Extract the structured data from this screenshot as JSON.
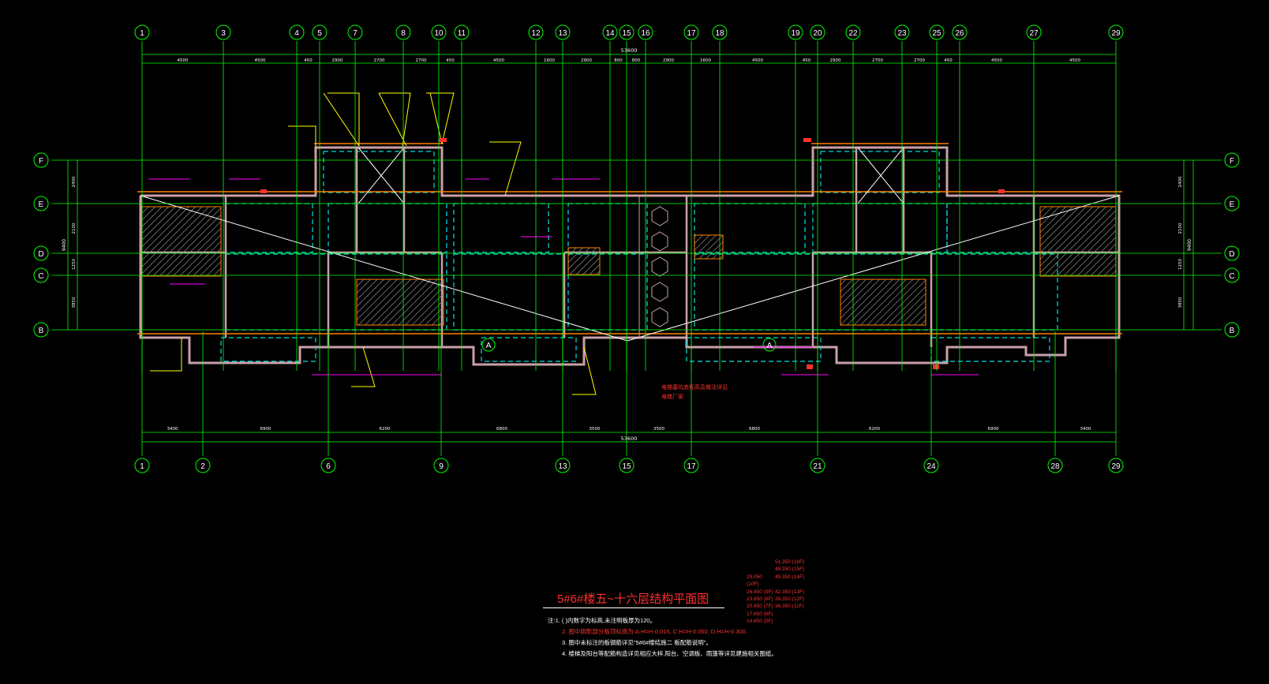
{
  "drawing": {
    "title": "5#6#楼五~十六层结构平面图",
    "total_dim_top": "53600",
    "total_dim_bottom": "53600",
    "section_mark": "A",
    "red_note": "电梯基坑底标高及做法详见电梯厂家"
  },
  "axes": {
    "top": [
      "1",
      "3",
      "4",
      "5",
      "7",
      "8",
      "10",
      "11",
      "12",
      "13",
      "14",
      "15",
      "16",
      "17",
      "18",
      "19",
      "20",
      "22",
      "23",
      "25",
      "26",
      "27",
      "29"
    ],
    "bottom": [
      "1",
      "2",
      "6",
      "9",
      "13",
      "15",
      "17",
      "21",
      "24",
      "28",
      "29"
    ],
    "rows": [
      "F",
      "E",
      "D",
      "C",
      "B"
    ]
  },
  "dims": {
    "top": [
      "4500",
      "4500",
      "450",
      "2900",
      "2700",
      "2700",
      "450",
      "4500",
      "1600",
      "2900",
      "800",
      "800",
      "2900",
      "1600",
      "4500",
      "450",
      "2900",
      "2700",
      "2700",
      "450",
      "4500",
      "4500"
    ],
    "bottom": [
      "3400",
      "6900",
      "6200",
      "6800",
      "3500",
      "3500",
      "6800",
      "6200",
      "6900",
      "3400"
    ],
    "left": [
      "2400",
      "2100",
      "1250",
      "3850"
    ],
    "left_total": "9400",
    "right": [
      "2400",
      "2100",
      "1250",
      "3850"
    ],
    "right_total": "9400"
  },
  "notes": [
    "注:1. ( )内数字为标高,未注明板厚为120。",
    "2. 图中阴影部分板顶标高为 A:H=H-0.015, C:H=H-0.050, D:H=H-0.300.",
    "3. 图中未标注的板钢筋详见\"5#6#楼结施二 板配筋说明\"。",
    "4. 楼梯及阳台等配筋构造详见相应大样,阳台、空调板、雨篷等详见建施相关图纸。"
  ],
  "levels": [
    [
      "",
      "51.350 (16F)"
    ],
    [
      "",
      "48.350 (15F)"
    ],
    [
      "29.050 (10F)",
      "45.350 (14F)"
    ],
    [
      "26.850 (9F)",
      "42.350 (13F)"
    ],
    [
      "23.850 (8F)",
      "39.350 (12F)"
    ],
    [
      "20.850 (7F)",
      "36.350 (11F)"
    ],
    [
      "17.850 (6F)",
      ""
    ],
    [
      "14.850 (5F)",
      ""
    ]
  ],
  "colors": {
    "background": "#000000",
    "axis": "#00ff00",
    "wall": "#c8a0a8",
    "beam": "#ff8000",
    "dashed": "#00e0e0",
    "yellow": "#ffff00",
    "magenta": "#ff00ff",
    "red": "#ff3030",
    "white": "#ffffff"
  }
}
